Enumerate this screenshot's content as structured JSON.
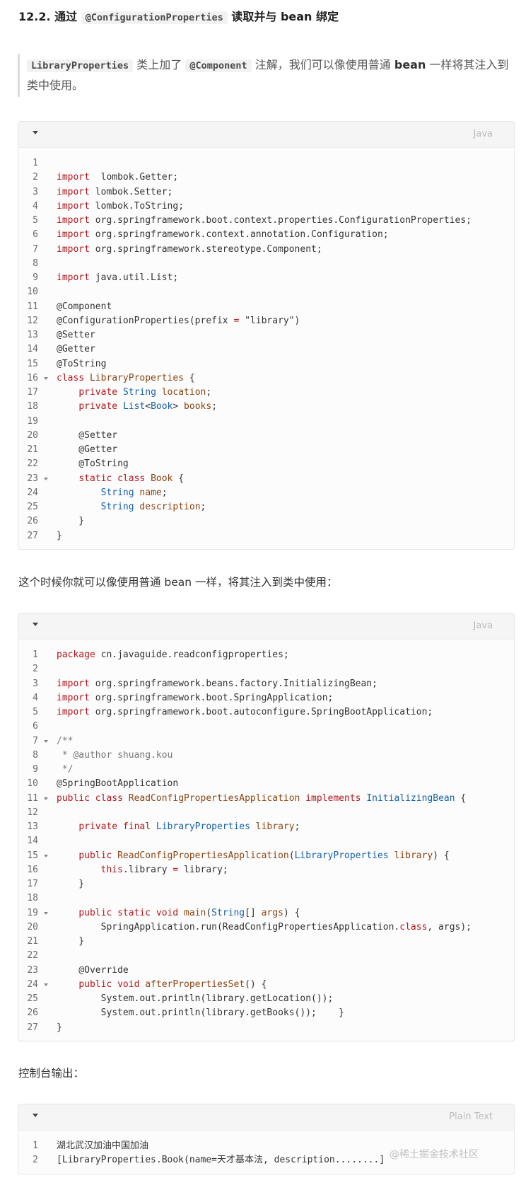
{
  "heading": {
    "prefix": "12.2. 通过",
    "code": "@ConfigurationProperties",
    "suffix": "读取并与 bean 绑定"
  },
  "note": {
    "code1": "LibraryProperties",
    "t1": "类上加了",
    "code2": "@Component",
    "t2": "注解，我们可以像使用普通",
    "bold": "bean",
    "t3": "一样将其注入到类中使用。"
  },
  "block1": {
    "lang": "Java",
    "lines": [
      {
        "n": "1",
        "fold": false,
        "parts": []
      },
      {
        "n": "2",
        "fold": false,
        "parts": [
          [
            "kw",
            "import"
          ],
          [
            "",
            "  lombok.Getter;"
          ]
        ]
      },
      {
        "n": "3",
        "fold": false,
        "parts": [
          [
            "kw",
            "import"
          ],
          [
            "",
            " lombok.Setter;"
          ]
        ]
      },
      {
        "n": "4",
        "fold": false,
        "parts": [
          [
            "kw",
            "import"
          ],
          [
            "",
            " lombok.ToString;"
          ]
        ]
      },
      {
        "n": "5",
        "fold": false,
        "parts": [
          [
            "kw",
            "import"
          ],
          [
            "",
            " org.springframework.boot.context.properties.ConfigurationProperties;"
          ]
        ]
      },
      {
        "n": "6",
        "fold": false,
        "parts": [
          [
            "kw",
            "import"
          ],
          [
            "",
            " org.springframework.context.annotation.Configuration;"
          ]
        ]
      },
      {
        "n": "7",
        "fold": false,
        "parts": [
          [
            "kw",
            "import"
          ],
          [
            "",
            " org.springframework.stereotype.Component;"
          ]
        ]
      },
      {
        "n": "8",
        "fold": false,
        "parts": []
      },
      {
        "n": "9",
        "fold": false,
        "parts": [
          [
            "kw",
            "import"
          ],
          [
            "",
            " java.util.List;"
          ]
        ]
      },
      {
        "n": "10",
        "fold": false,
        "parts": []
      },
      {
        "n": "11",
        "fold": false,
        "parts": [
          [
            "an",
            "@Component"
          ]
        ]
      },
      {
        "n": "12",
        "fold": false,
        "parts": [
          [
            "an",
            "@ConfigurationProperties(prefix "
          ],
          [
            "kw",
            "="
          ],
          [
            "",
            " \"library\")"
          ]
        ]
      },
      {
        "n": "13",
        "fold": false,
        "parts": [
          [
            "an",
            "@Setter"
          ]
        ]
      },
      {
        "n": "14",
        "fold": false,
        "parts": [
          [
            "an",
            "@Getter"
          ]
        ]
      },
      {
        "n": "15",
        "fold": false,
        "parts": [
          [
            "an",
            "@ToString"
          ]
        ]
      },
      {
        "n": "16",
        "fold": true,
        "parts": [
          [
            "kw",
            "class"
          ],
          [
            "",
            " "
          ],
          [
            "var",
            "LibraryProperties"
          ],
          [
            "",
            " {"
          ]
        ]
      },
      {
        "n": "17",
        "fold": false,
        "parts": [
          [
            "",
            "    "
          ],
          [
            "kw",
            "private"
          ],
          [
            "",
            " "
          ],
          [
            "ty",
            "String"
          ],
          [
            "",
            " "
          ],
          [
            "var",
            "location"
          ],
          [
            "",
            ";"
          ]
        ]
      },
      {
        "n": "18",
        "fold": false,
        "parts": [
          [
            "",
            "    "
          ],
          [
            "kw",
            "private"
          ],
          [
            "",
            " "
          ],
          [
            "ty",
            "List"
          ],
          [
            "",
            "<"
          ],
          [
            "ty",
            "Book"
          ],
          [
            "",
            "> "
          ],
          [
            "var",
            "books"
          ],
          [
            "",
            ";"
          ]
        ]
      },
      {
        "n": "19",
        "fold": false,
        "parts": []
      },
      {
        "n": "20",
        "fold": false,
        "parts": [
          [
            "",
            "    @Setter"
          ]
        ]
      },
      {
        "n": "21",
        "fold": false,
        "parts": [
          [
            "",
            "    @Getter"
          ]
        ]
      },
      {
        "n": "22",
        "fold": false,
        "parts": [
          [
            "",
            "    @ToString"
          ]
        ]
      },
      {
        "n": "23",
        "fold": true,
        "parts": [
          [
            "",
            "    "
          ],
          [
            "kw",
            "static class"
          ],
          [
            "",
            " "
          ],
          [
            "var",
            "Book"
          ],
          [
            "",
            " {"
          ]
        ]
      },
      {
        "n": "24",
        "fold": false,
        "parts": [
          [
            "",
            "        "
          ],
          [
            "ty",
            "String"
          ],
          [
            "",
            " "
          ],
          [
            "var",
            "name"
          ],
          [
            "",
            ";"
          ]
        ]
      },
      {
        "n": "25",
        "fold": false,
        "parts": [
          [
            "",
            "        "
          ],
          [
            "ty",
            "String"
          ],
          [
            "",
            " "
          ],
          [
            "var",
            "description"
          ],
          [
            "",
            ";"
          ]
        ]
      },
      {
        "n": "26",
        "fold": false,
        "parts": [
          [
            "",
            "    }"
          ]
        ]
      },
      {
        "n": "27",
        "fold": false,
        "parts": [
          [
            "",
            "}"
          ]
        ]
      }
    ]
  },
  "para1": "这个时候你就可以像使用普通 bean 一样，将其注入到类中使用：",
  "block2": {
    "lang": "Java",
    "lines": [
      {
        "n": "1",
        "fold": false,
        "parts": [
          [
            "kw",
            "package"
          ],
          [
            "",
            " cn.javaguide.readconfigproperties;"
          ]
        ]
      },
      {
        "n": "2",
        "fold": false,
        "parts": []
      },
      {
        "n": "3",
        "fold": false,
        "parts": [
          [
            "kw",
            "import"
          ],
          [
            "",
            " org.springframework.beans.factory.InitializingBean;"
          ]
        ]
      },
      {
        "n": "4",
        "fold": false,
        "parts": [
          [
            "kw",
            "import"
          ],
          [
            "",
            " org.springframework.boot.SpringApplication;"
          ]
        ]
      },
      {
        "n": "5",
        "fold": false,
        "parts": [
          [
            "kw",
            "import"
          ],
          [
            "",
            " org.springframework.boot.autoconfigure.SpringBootApplication;"
          ]
        ]
      },
      {
        "n": "6",
        "fold": false,
        "parts": []
      },
      {
        "n": "7",
        "fold": true,
        "parts": [
          [
            "cm",
            "/**"
          ]
        ]
      },
      {
        "n": "8",
        "fold": false,
        "parts": [
          [
            "cm",
            " * @author shuang.kou"
          ]
        ]
      },
      {
        "n": "9",
        "fold": false,
        "parts": [
          [
            "cm",
            " */"
          ]
        ]
      },
      {
        "n": "10",
        "fold": false,
        "parts": [
          [
            "an",
            "@SpringBootApplication"
          ]
        ]
      },
      {
        "n": "11",
        "fold": true,
        "parts": [
          [
            "kw",
            "public class"
          ],
          [
            "",
            " "
          ],
          [
            "var",
            "ReadConfigPropertiesApplication"
          ],
          [
            "",
            " "
          ],
          [
            "kw",
            "implements"
          ],
          [
            "",
            " "
          ],
          [
            "ty",
            "InitializingBean"
          ],
          [
            "",
            " {"
          ]
        ]
      },
      {
        "n": "12",
        "fold": false,
        "parts": []
      },
      {
        "n": "13",
        "fold": false,
        "parts": [
          [
            "",
            "    "
          ],
          [
            "kw",
            "private final"
          ],
          [
            "",
            " "
          ],
          [
            "ty",
            "LibraryProperties"
          ],
          [
            "",
            " "
          ],
          [
            "var",
            "library"
          ],
          [
            "",
            ";"
          ]
        ]
      },
      {
        "n": "14",
        "fold": false,
        "parts": []
      },
      {
        "n": "15",
        "fold": true,
        "parts": [
          [
            "",
            "    "
          ],
          [
            "kw",
            "public"
          ],
          [
            "",
            " "
          ],
          [
            "var",
            "ReadConfigPropertiesApplication"
          ],
          [
            "",
            "("
          ],
          [
            "ty",
            "LibraryProperties"
          ],
          [
            "",
            " "
          ],
          [
            "var",
            "library"
          ],
          [
            "",
            ") {"
          ]
        ]
      },
      {
        "n": "16",
        "fold": false,
        "parts": [
          [
            "",
            "        "
          ],
          [
            "kw",
            "this"
          ],
          [
            "",
            ".library "
          ],
          [
            "kw",
            "="
          ],
          [
            "",
            " library;"
          ]
        ]
      },
      {
        "n": "17",
        "fold": false,
        "parts": [
          [
            "",
            "    }"
          ]
        ]
      },
      {
        "n": "18",
        "fold": false,
        "parts": []
      },
      {
        "n": "19",
        "fold": true,
        "parts": [
          [
            "",
            "    "
          ],
          [
            "kw",
            "public static void"
          ],
          [
            "",
            " "
          ],
          [
            "var",
            "main"
          ],
          [
            "",
            "("
          ],
          [
            "ty",
            "String"
          ],
          [
            "",
            "[] "
          ],
          [
            "var",
            "args"
          ],
          [
            "",
            ") {"
          ]
        ]
      },
      {
        "n": "20",
        "fold": false,
        "parts": [
          [
            "",
            "        SpringApplication.run(ReadConfigPropertiesApplication."
          ],
          [
            "kw",
            "class"
          ],
          [
            "",
            ", args);"
          ]
        ]
      },
      {
        "n": "21",
        "fold": false,
        "parts": [
          [
            "",
            "    }"
          ]
        ]
      },
      {
        "n": "22",
        "fold": false,
        "parts": []
      },
      {
        "n": "23",
        "fold": false,
        "parts": [
          [
            "",
            "    @Override"
          ]
        ]
      },
      {
        "n": "24",
        "fold": true,
        "parts": [
          [
            "",
            "    "
          ],
          [
            "kw",
            "public void"
          ],
          [
            "",
            " "
          ],
          [
            "var",
            "afterPropertiesSet"
          ],
          [
            "",
            "() {"
          ]
        ]
      },
      {
        "n": "25",
        "fold": false,
        "parts": [
          [
            "",
            "        System.out.println(library.getLocation());"
          ]
        ]
      },
      {
        "n": "26",
        "fold": false,
        "parts": [
          [
            "",
            "        System.out.println(library.getBooks());    }"
          ]
        ]
      },
      {
        "n": "27",
        "fold": false,
        "parts": [
          [
            "",
            "}"
          ]
        ]
      }
    ]
  },
  "para2": "控制台输出：",
  "block3": {
    "lang": "Plain Text",
    "lines": [
      {
        "n": "1",
        "fold": false,
        "parts": [
          [
            "",
            "湖北武汉加油中国加油"
          ]
        ]
      },
      {
        "n": "2",
        "fold": false,
        "parts": [
          [
            "",
            "[LibraryProperties.Book(name=天才基本法, description........]"
          ]
        ]
      }
    ]
  },
  "watermark": "@稀土掘金技术社区"
}
